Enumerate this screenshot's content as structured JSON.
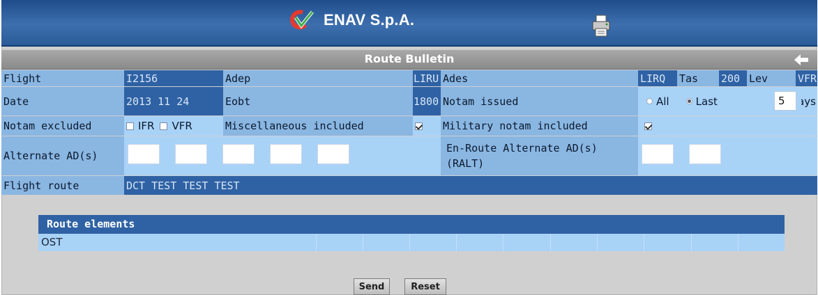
{
  "header": {
    "brand": "ENAV S.p.A.",
    "logo_icon": "enav-logo-icon",
    "print_icon": "printer-icon"
  },
  "page": {
    "title": "Route Bulletin",
    "back_icon": "arrow-left-icon"
  },
  "flight_row": {
    "flight_label": "Flight",
    "flight_value": "I2156",
    "adep_label": "Adep",
    "adep_value": "LIRU",
    "ades_label": "Ades",
    "ades_value": "LIRQ",
    "tas_label": "Tas",
    "tas_value": "200",
    "lev_label": "Lev",
    "lev_value": "VFR"
  },
  "date_row": {
    "date_label": "Date",
    "date_value": "2013 11 24",
    "eobt_label": "Eobt",
    "eobt_value": "1800",
    "notam_issued_label": "Notam issued",
    "all_label": "All",
    "last_label": "Last",
    "selected": "Last",
    "days_value": "5",
    "days_label": "days"
  },
  "notam_row": {
    "excluded_label": "Notam excluded",
    "ifr_label": "IFR",
    "ifr_checked": false,
    "vfr_label": "VFR",
    "vfr_checked": false,
    "misc_label": "Miscellaneous included",
    "misc_checked": true,
    "military_label": "Military notam included",
    "military_checked": true
  },
  "alternate_row": {
    "alternate_label": "Alternate AD(s)",
    "enroute_label_line1": "En-Route Alternate AD(s)",
    "enroute_label_line2": "(RALT)"
  },
  "route_row": {
    "label": "Flight route",
    "value": "DCT TEST TEST TEST"
  },
  "route_elements": {
    "header": "Route elements",
    "items": [
      "OST"
    ]
  },
  "buttons": {
    "send": "Send",
    "reset": "Reset"
  },
  "colors": {
    "header_blue": "#2a5a98",
    "row_mid": "#8ab6e2",
    "row_light": "#a9d2f7",
    "cell_dark": "#2f62a4"
  }
}
